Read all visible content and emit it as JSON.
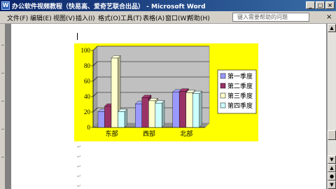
{
  "window": {
    "title": "办公软件视频教程（快易高、爱奇艺联合出品） - Microsoft Word",
    "icon": "word-app-icon",
    "buttons": [
      "_",
      "□",
      "×"
    ]
  },
  "menu": {
    "items": [
      "文件(F)",
      "编辑(E)",
      "视图(V)",
      "插入(I)",
      "格式(O)",
      "工具(T)",
      "表格(A)",
      "窗口(W)",
      "帮助(H)"
    ],
    "help_placeholder": "键入需要帮助的问题",
    "close_glyph": "×"
  },
  "document": {
    "paragraph_mark": "↵"
  },
  "scrollbar": {
    "up": "▲",
    "down": "▼",
    "prev_page": "▲",
    "select_browse": "●",
    "next_page": "▼"
  },
  "colors": {
    "title_start": "#0a246a",
    "title_end": "#3a6ea5",
    "chart_background": "#ffff00",
    "plot_area": "#c0c0c0",
    "series_colors": [
      "#9999ff",
      "#993366",
      "#ffffcc",
      "#ccffff"
    ]
  },
  "chart_data": {
    "type": "bar",
    "style": "3d-clustered-column",
    "categories": [
      "东部",
      "西部",
      "北部"
    ],
    "series": [
      {
        "name": "第一季度",
        "values": [
          20.4,
          30.6,
          45.9
        ]
      },
      {
        "name": "第二季度",
        "values": [
          27.4,
          38.6,
          46.9
        ]
      },
      {
        "name": "第三季度",
        "values": [
          90,
          34.6,
          45
        ]
      },
      {
        "name": "第四季度",
        "values": [
          20.4,
          31.6,
          43.9
        ]
      }
    ],
    "ylim": [
      0,
      100
    ],
    "yticks": [
      0,
      20,
      40,
      60,
      80,
      100
    ],
    "grid": true,
    "legend": "right"
  }
}
